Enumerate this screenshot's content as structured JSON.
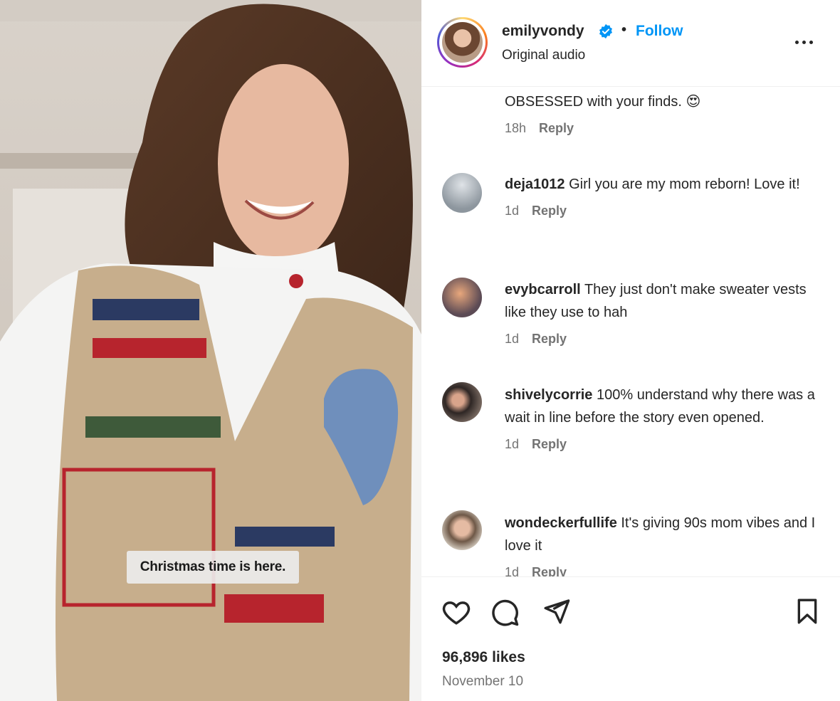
{
  "post": {
    "username": "emilyvondy",
    "separator": "•",
    "follow_label": "Follow",
    "audio_label": "Original audio",
    "caption_overlay": "Christmas time is here.",
    "likes": "96,896 likes",
    "date": "November 10",
    "reply_label": "Reply"
  },
  "comments": [
    {
      "username": "",
      "text": "OBSESSED with your finds. 😍",
      "age": "18h"
    },
    {
      "username": "deja1012",
      "text": "Girl you are my mom reborn! Love it!",
      "age": "1d"
    },
    {
      "username": "evybcarroll",
      "text": "They just don't make sweater vests like they use to hah",
      "age": "1d"
    },
    {
      "username": "shivelycorrie",
      "text": "100% understand why there was a wait in line before the story even opened.",
      "age": "1d"
    },
    {
      "username": "wondeckerfullife",
      "text": "It's giving 90s mom vibes and I love it",
      "age": "1d"
    }
  ],
  "colors": {
    "follow": "#0095f6",
    "text": "#262626",
    "muted": "#737373"
  },
  "icons": [
    "verified-badge-icon",
    "more-options-icon",
    "heart-icon",
    "comment-icon",
    "share-icon",
    "bookmark-icon"
  ]
}
